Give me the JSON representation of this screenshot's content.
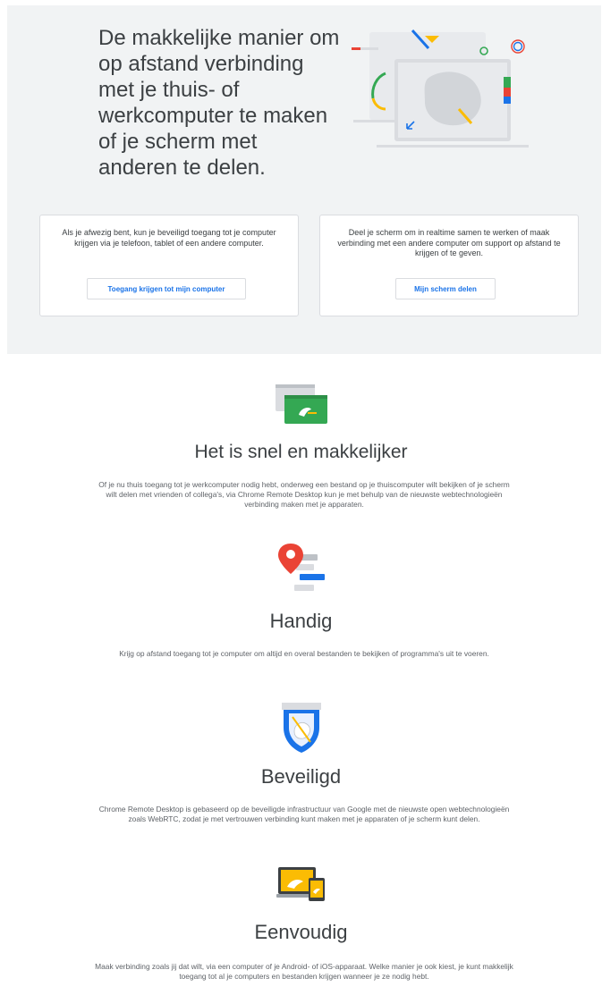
{
  "hero": {
    "title": "De makkelijke manier om op afstand verbinding met je thuis- of werkcomputer te maken of je scherm met anderen te delen.",
    "illustration_icon": "devices-illustration-icon",
    "colors": {
      "background": "#f1f3f4",
      "accent_blue": "#1a73e8",
      "accent_green": "#34a853",
      "accent_yellow": "#fbbc04",
      "accent_red": "#ea4335"
    }
  },
  "cards": [
    {
      "text": "Als je afwezig bent, kun je beveiligd toegang tot je computer krijgen via je telefoon, tablet of een andere computer.",
      "button_label": "Toegang krijgen tot mijn computer"
    },
    {
      "text": "Deel je scherm om in realtime samen te werken of maak verbinding met een andere computer om support op afstand te krijgen of te geven.",
      "button_label": "Mijn scherm delen"
    }
  ],
  "features": [
    {
      "icon": "fast-screens-icon",
      "title": "Het is snel en makkelijker",
      "description": "Of je nu thuis toegang tot je werkcomputer nodig hebt, onderweg een bestand op je thuiscomputer wilt bekijken of je scherm wilt delen met vrienden of collega's, via Chrome Remote Desktop kun je met behulp van de nieuwste webtechnologieën verbinding maken met je apparaten."
    },
    {
      "icon": "location-pin-icon",
      "title": "Handig",
      "description": "Krijg op afstand toegang tot je computer om altijd en overal bestanden te bekijken of programma's uit te voeren."
    },
    {
      "icon": "shield-icon",
      "title": "Beveiligd",
      "description": "Chrome Remote Desktop is gebaseerd op de beveiligde infrastructuur van Google met de nieuwste open webtechnologieën zoals WebRTC, zodat je met vertrouwen verbinding kunt maken met je apparaten of je scherm kunt delen."
    },
    {
      "icon": "devices-icon",
      "title": "Eenvoudig",
      "description": "Maak verbinding zoals jij dat wilt, via een computer of je Android- of iOS-apparaat. Welke manier je ook kiest, je kunt makkelijk toegang tot al je computers en bestanden krijgen wanneer je ze nodig hebt."
    }
  ]
}
